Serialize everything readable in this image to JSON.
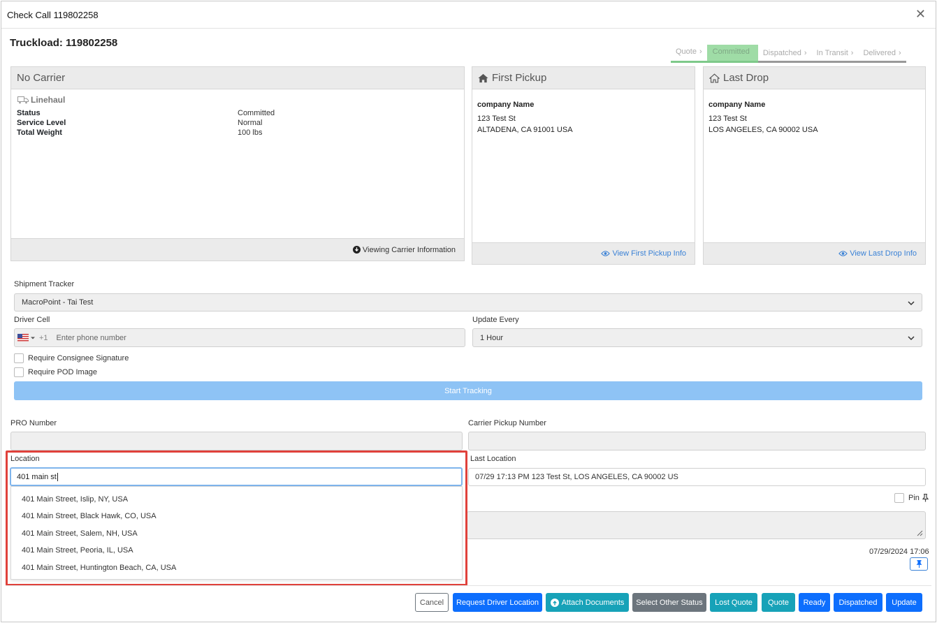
{
  "window": {
    "title": "Check Call 119802258"
  },
  "truckload": {
    "title": "Truckload: 119802258"
  },
  "steps": [
    "Quote",
    "Committed",
    "Dispatched",
    "In Transit",
    "Delivered"
  ],
  "carrier": {
    "title": "No Carrier",
    "section": "Linehaul",
    "rows": [
      {
        "k": "Status",
        "v": "Committed"
      },
      {
        "k": "Service Level",
        "v": "Normal"
      },
      {
        "k": "Total Weight",
        "v": "100 lbs"
      }
    ],
    "footer_link": "Viewing Carrier Information"
  },
  "first_pickup": {
    "title": "First Pickup",
    "company": "company Name",
    "line1": "123 Test St",
    "line2": "ALTADENA, CA 91001 USA",
    "link": "View First Pickup Info"
  },
  "last_drop": {
    "title": "Last Drop",
    "company": "company Name",
    "line1": "123 Test St",
    "line2": "LOS ANGELES, CA 90002 USA",
    "link": "View Last Drop Info"
  },
  "tracker": {
    "label": "Shipment Tracker",
    "value": "MacroPoint - Tai Test",
    "driver_cell_label": "Driver Cell",
    "phone_code": "+1",
    "phone_placeholder": "Enter phone number",
    "update_every_label": "Update Every",
    "update_every_value": "1 Hour",
    "require_signature": "Require Consignee Signature",
    "require_pod": "Require POD Image",
    "start_button": "Start Tracking"
  },
  "form": {
    "pro_label": "PRO Number",
    "carrier_pickup_label": "Carrier Pickup Number",
    "location_label": "Location",
    "location_value": "401 main st",
    "last_location_label": "Last Location",
    "last_location_value": "07/29 17:13 PM 123 Test St, LOS ANGELES, CA 90002 US",
    "pin_label": "Pin",
    "timestamp": "07/29/2024 17:06"
  },
  "suggestions": [
    "401 Main Street, Islip, NY, USA",
    "401 Main Street, Black Hawk, CO, USA",
    "401 Main Street, Salem, NH, USA",
    "401 Main Street, Peoria, IL, USA",
    "401 Main Street, Huntington Beach, CA, USA"
  ],
  "buttons": {
    "cancel": "Cancel",
    "request_driver": "Request Driver Location",
    "attach": "Attach Documents",
    "select_other": "Select Other Status",
    "lost_quote": "Lost Quote",
    "quote": "Quote",
    "ready": "Ready",
    "dispatched": "Dispatched",
    "update": "Update"
  },
  "colors": {
    "primary": "#0d6efd",
    "teal": "#17a2b8",
    "secondary": "#6c757d",
    "highlight": "#e0413b",
    "committed_step": "#9fdca6"
  }
}
